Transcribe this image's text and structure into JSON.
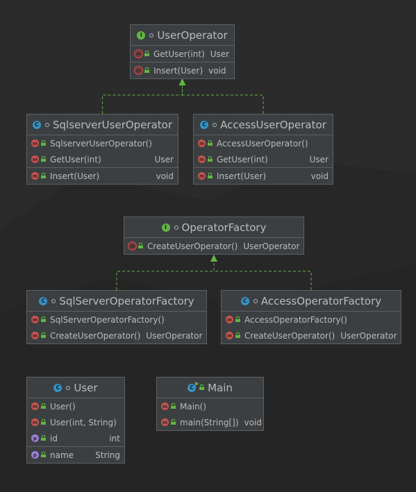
{
  "nodes": {
    "user_operator": {
      "name": "UserOperator",
      "kind_letter": "I",
      "members": [
        {
          "icon": "m",
          "name": "GetUser(int)",
          "type": "User"
        },
        {
          "icon": "m",
          "name": "Insert(User)",
          "type": "void"
        }
      ]
    },
    "sqlserver_user_operator": {
      "name": "SqlserverUserOperator",
      "kind_letter": "C",
      "members": [
        {
          "icon": "m",
          "name": "SqlserverUserOperator()",
          "type": ""
        },
        {
          "icon": "m",
          "name": "GetUser(int)",
          "type": "User"
        },
        {
          "icon": "m",
          "name": "Insert(User)",
          "type": "void"
        }
      ]
    },
    "access_user_operator": {
      "name": "AccessUserOperator",
      "kind_letter": "C",
      "members": [
        {
          "icon": "m",
          "name": "AccessUserOperator()",
          "type": ""
        },
        {
          "icon": "m",
          "name": "GetUser(int)",
          "type": "User"
        },
        {
          "icon": "m",
          "name": "Insert(User)",
          "type": "void"
        }
      ]
    },
    "operator_factory": {
      "name": "OperatorFactory",
      "kind_letter": "I",
      "members": [
        {
          "icon": "m",
          "name": "CreateUserOperator()",
          "type": "UserOperator"
        }
      ]
    },
    "sqlserver_operator_factory": {
      "name": "SqlServerOperatorFactory",
      "kind_letter": "C",
      "members": [
        {
          "icon": "m",
          "name": "SqlServerOperatorFactory()",
          "type": ""
        },
        {
          "icon": "m",
          "name": "CreateUserOperator()",
          "type": "UserOperator"
        }
      ]
    },
    "access_operator_factory": {
      "name": "AccessOperatorFactory",
      "kind_letter": "C",
      "members": [
        {
          "icon": "m",
          "name": "AccessOperatorFactory()",
          "type": ""
        },
        {
          "icon": "m",
          "name": "CreateUserOperator()",
          "type": "UserOperator"
        }
      ]
    },
    "user": {
      "name": "User",
      "kind_letter": "C",
      "members": [
        {
          "icon": "m",
          "name": "User()",
          "type": ""
        },
        {
          "icon": "m",
          "name": "User(int, String)",
          "type": ""
        },
        {
          "icon": "p",
          "name": "id",
          "type": "int"
        },
        {
          "icon": "p",
          "name": "name",
          "type": "String"
        }
      ]
    },
    "main": {
      "name": "Main",
      "kind_letter": "C",
      "members": [
        {
          "icon": "m",
          "name": "Main()",
          "type": ""
        },
        {
          "icon": "m",
          "name": "main(String[])",
          "type": "void"
        }
      ]
    }
  },
  "member_icon_letters": {
    "m": "m",
    "p": "p"
  },
  "edges": [
    {
      "from": "sqlserver_user_operator",
      "to": "user_operator",
      "kind": "implements"
    },
    {
      "from": "access_user_operator",
      "to": "user_operator",
      "kind": "implements"
    },
    {
      "from": "sqlserver_operator_factory",
      "to": "operator_factory",
      "kind": "implements"
    },
    {
      "from": "access_operator_factory",
      "to": "operator_factory",
      "kind": "implements"
    }
  ],
  "colors": {
    "background": "#2b2b2b",
    "node_fill": "#3c3f41",
    "node_border": "#5e6062",
    "text": "#bbbbbb",
    "interface_icon": "#62b543",
    "class_icon": "#3592c4",
    "method_icon": "#c75450",
    "property_icon": "#9b7fd6",
    "edge": "#62b543"
  }
}
